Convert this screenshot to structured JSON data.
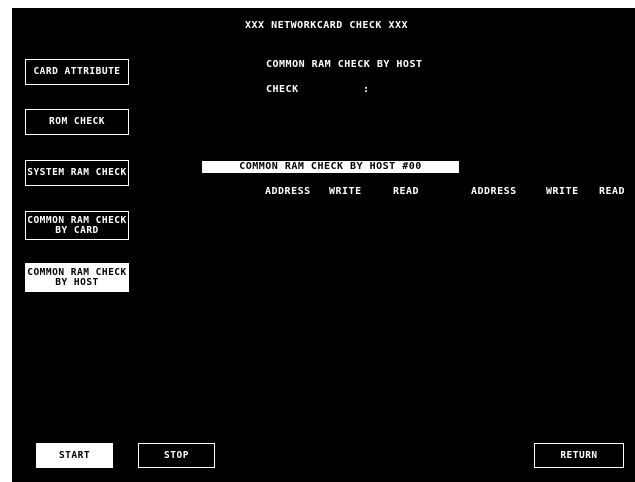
{
  "title": "XXX NETWORKCARD CHECK XXX",
  "header": {
    "mode_line": "COMMON RAM CHECK BY HOST",
    "check_label": "CHECK",
    "check_sep": ":"
  },
  "menu": {
    "card_attribute": "CARD ATTRIBUTE",
    "rom_check": "ROM CHECK",
    "system_ram_check": "SYSTEM RAM CHECK",
    "common_ram_by_card": "COMMON RAM CHECK\nBY CARD",
    "common_ram_by_host": "COMMON RAM CHECK\nBY HOST"
  },
  "table": {
    "banner": "COMMON RAM CHECK BY HOST #00",
    "columns": [
      "ADDRESS",
      "WRITE",
      "READ",
      "ADDRESS",
      "WRITE",
      "READ"
    ]
  },
  "footer": {
    "start": "START",
    "stop": "STOP",
    "return": "RETURN"
  }
}
